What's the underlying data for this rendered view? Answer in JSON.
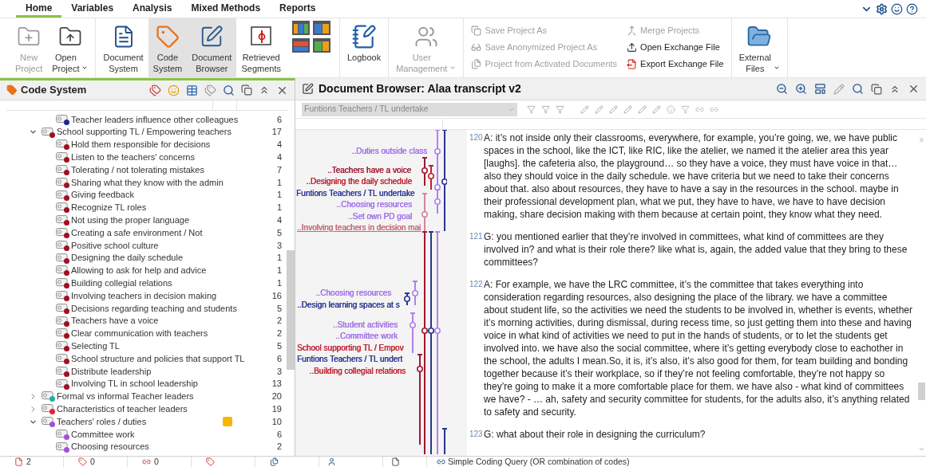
{
  "ribbon_tabs": [
    {
      "label": "Home",
      "selected": true
    },
    {
      "label": "Variables",
      "selected": false
    },
    {
      "label": "Analysis",
      "selected": false
    },
    {
      "label": "Mixed Methods",
      "selected": false
    },
    {
      "label": "Reports",
      "selected": false
    }
  ],
  "ribbon": {
    "groups": [
      {
        "buttons": [
          {
            "kind": "new",
            "label": "New Project",
            "disabled": true,
            "selected": false,
            "dropdown": false
          },
          {
            "kind": "open",
            "label": "Open Project",
            "disabled": false,
            "selected": false,
            "dropdown": true
          }
        ]
      },
      {
        "buttons": [
          {
            "kind": "document_system",
            "label": "Document System",
            "disabled": false,
            "selected": false,
            "dropdown": false
          },
          {
            "kind": "code_system",
            "label": "Code System",
            "disabled": false,
            "selected": true,
            "dropdown": false
          },
          {
            "kind": "document_browser",
            "label": "Document Browser",
            "disabled": false,
            "selected": true,
            "dropdown": false
          },
          {
            "kind": "retrieved_segments",
            "label": "Retrieved Segments",
            "disabled": false,
            "selected": false,
            "dropdown": false
          },
          {
            "kind": "layouts",
            "selected": false
          }
        ]
      },
      {
        "buttons": [
          {
            "kind": "logbook",
            "label": "Logbook",
            "disabled": false,
            "selected": false,
            "dropdown": false
          }
        ]
      },
      {
        "buttons": [
          {
            "kind": "user_management",
            "label": "User Management",
            "disabled": true,
            "selected": false,
            "dropdown": true
          }
        ]
      },
      {
        "columns": [
          [
            {
              "kind": "save_as",
              "label": "Save Project As",
              "disabled": true
            },
            {
              "kind": "save_anonymized",
              "label": "Save Anonymized Project As",
              "disabled": true
            },
            {
              "kind": "from_documents",
              "label": "Project from Activated Documents",
              "disabled": true
            }
          ],
          [
            {
              "kind": "merge",
              "label": "Merge Projects",
              "disabled": true
            },
            {
              "kind": "open_exchange",
              "label": "Open Exchange File",
              "disabled": false
            },
            {
              "kind": "export_exchange",
              "label": "Export Exchange File",
              "disabled": false
            }
          ]
        ]
      },
      {
        "buttons": [
          {
            "kind": "external_files",
            "label": "External Files",
            "disabled": false,
            "selected": false,
            "dropdown": true
          }
        ]
      }
    ]
  },
  "code_system": {
    "title": "Code System",
    "tree": [
      {
        "children": [
          {
            "label": "Teacher leaders influence other colleagues",
            "count": "6",
            "color": "#1a2a9a"
          }
        ]
      },
      {
        "label": "School supporting TL / Empowering teachers",
        "count": "17",
        "color": "#a01020",
        "expanded": true,
        "children": [
          {
            "label": "Hold them responsible for decisions",
            "count": "4",
            "color": "#a01020"
          },
          {
            "label": "Listen to the teachers' concerns",
            "count": "4",
            "color": "#a01020"
          },
          {
            "label": "Tolerating / not tolerating mistakes",
            "count": "7",
            "color": "#a01020"
          },
          {
            "label": "Sharing what they know with the admin",
            "count": "1",
            "color": "#a01020"
          },
          {
            "label": "Giving feedback",
            "count": "1",
            "color": "#a01020"
          },
          {
            "label": "Recognize TL roles",
            "count": "1",
            "color": "#a01020"
          },
          {
            "label": "Not using the proper language",
            "count": "4",
            "color": "#a01020"
          },
          {
            "label": "Creating a safe environment / Not",
            "count": "5",
            "color": "#a01020"
          },
          {
            "label": "Positive school culture",
            "count": "3",
            "color": "#a01020"
          },
          {
            "label": "Designing the daily schedule",
            "count": "1",
            "color": "#a01020"
          },
          {
            "label": "Allowing to ask for help and advice",
            "count": "1",
            "color": "#a01020"
          },
          {
            "label": "Building collegial relations",
            "count": "1",
            "color": "#a01020"
          },
          {
            "label": "Involving teachers in decision making",
            "count": "16",
            "color": "#a01020"
          },
          {
            "label": "Decisions regarding teaching and students",
            "count": "5",
            "color": "#a01020"
          },
          {
            "label": "Teachers have a voice",
            "count": "2",
            "color": "#a01020"
          },
          {
            "label": "Clear communication with teachers",
            "count": "2",
            "color": "#a01020"
          },
          {
            "label": "Selecting TL",
            "count": "5",
            "color": "#a01020"
          },
          {
            "label": "School structure and policies that support TL",
            "count": "6",
            "color": "#a01020"
          },
          {
            "label": "Distribute leadership",
            "count": "3",
            "color": "#a01020"
          },
          {
            "label": "Involving TL in school leadership",
            "count": "13",
            "color": "#a01020"
          }
        ]
      },
      {
        "label": "Formal vs informal Teacher leaders",
        "count": "20",
        "color": "#20b0a0",
        "expanded": false
      },
      {
        "label": "Characteristics of teacher leaders",
        "count": "19",
        "color": "#e82030",
        "expanded": false
      },
      {
        "label": "Teachers' roles / duties",
        "count": "10",
        "color": "#a050e0",
        "expanded": true,
        "memo": true,
        "children": [
          {
            "label": "Committee work",
            "count": "6",
            "color": "#a050e0"
          },
          {
            "label": "Choosing resources",
            "count": "2",
            "color": "#a050e0"
          }
        ]
      }
    ]
  },
  "document_browser": {
    "title": "Document Browser: Alaa transcript v2",
    "code_filter": "Funtions Teachers / TL undertake",
    "margin_codes": [
      {
        "label": "..Duties outside class",
        "color": "#a070e8",
        "underlined": false
      },
      {
        "label": "..Teachers have a voice",
        "color": "#a01830",
        "underlined": false
      },
      {
        "label": "..Designing the daily schedule",
        "color": "#c02030",
        "underlined": false
      },
      {
        "label": "Funtions Teachers / TL undertake",
        "color": "#2a3590",
        "underlined": false
      },
      {
        "label": "..Choosing resources",
        "color": "#a070e8",
        "underlined": false
      },
      {
        "label": "..Set own PD goal",
        "color": "#a070e8",
        "underlined": false
      },
      {
        "label": "..Involving teachers in decision mai",
        "color": "#c06878",
        "underlined": true
      },
      {
        "label": "..Choosing resources",
        "color": "#a070e8",
        "underlined": false
      },
      {
        "label": "..Design learning spaces at s",
        "color": "#2a3590",
        "underlined": false
      },
      {
        "label": "..Student activities",
        "color": "#a070e8",
        "underlined": false
      },
      {
        "label": "..Committee work",
        "color": "#a070e8",
        "underlined": false
      },
      {
        "label": "School supporting TL / Empov",
        "color": "#c02030",
        "underlined": false
      },
      {
        "label": "Funtions Teachers / TL undert",
        "color": "#2a3590",
        "underlined": false
      },
      {
        "label": "..Building collegial relations",
        "color": "#c02030",
        "underlined": false
      }
    ],
    "paragraphs": [
      {
        "number": "120",
        "text": "A: it’s not inside only their classrooms, everywhere, for example, you’re going, we, we have public spaces in the school, like the ICT, like RIC, like the atelier, we named it the atelier area this year [laughs]. the cafeteria also, the playground… so they have a voice, they must have voice in that… also they should voice in the daily schedule. we have criteria but we need to take their concerns about that. also about resources, they have to have a say in the resources in the school. maybe in their professional development plan, what we put, they have to have, we have to have decision making, share decision making with them because at certain point, they know what they need."
      },
      {
        "number": "121",
        "text": "G: you mentioned earlier that they’re involved in committees, what kind of committees are they involved in? and what is their role there? like what is, again, the added value that they bring to these committees?"
      },
      {
        "number": "122",
        "text": "A: For example, we have the LRC committee, it’s the committee that takes everything into consideration regarding resources, also designing the place of the library. we have a committee about student life, so the activities we need the students to be involved in, whether is events, whether it’s morning activities, during dismissal, during recess time, so just getting them into these and having voice in what kind of activities we need to put in the hands of students, or to let the students get involved into. we have also the social committee, where it’s getting everybody close to eachother in the school, the adults I mean.So, it is, it’s also, it’s also good for them, for team building and bonding together because it’s their workplace, so if they’re not feeling comfortable, they’re not happy so they’re going to make it a more comfortable place for them. we have also - what kind of committees we have? - … ah, safety and security committee for students, for the adults also, it’s anything related to safety and security."
      },
      {
        "number": "123",
        "text": "G: what about their role in designing the curriculum?"
      }
    ]
  },
  "status_bar": {
    "counts": [
      {
        "kind": "documents",
        "value": "2"
      },
      {
        "kind": "codes",
        "value": "0"
      },
      {
        "kind": "links",
        "value": "0"
      }
    ],
    "query": "Simple Coding Query (OR combination of codes)"
  }
}
